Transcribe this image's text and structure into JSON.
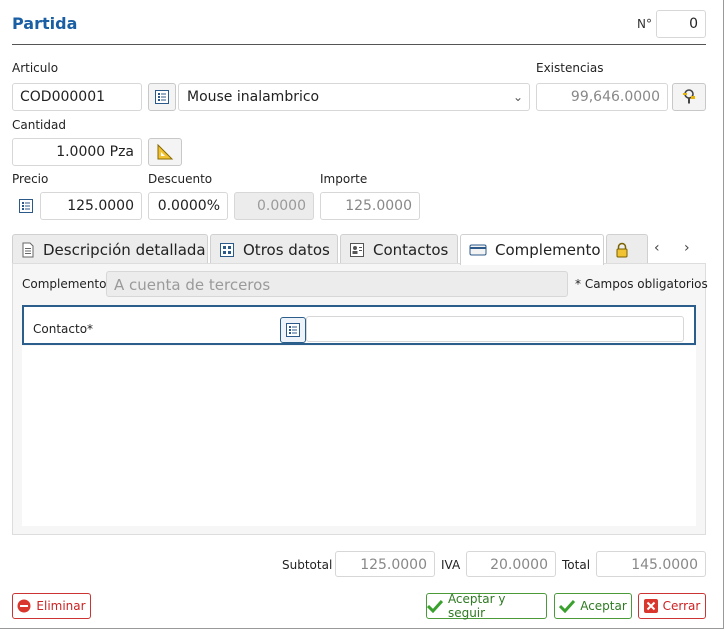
{
  "dialog": {
    "title": "Partida",
    "number_label": "N°",
    "number_value": "0"
  },
  "articulo": {
    "label": "Articulo",
    "code": "COD000001",
    "name": "Mouse inalambrico",
    "existencias_label": "Existencias",
    "existencias_value": "99,646.0000"
  },
  "cantidad": {
    "label": "Cantidad",
    "value": "1.0000 Pza"
  },
  "precio": {
    "label": "Precio",
    "value": "125.0000"
  },
  "descuento": {
    "label": "Descuento",
    "percent": "0.0000%",
    "amount": "0.0000"
  },
  "importe": {
    "label": "Importe",
    "value": "125.0000"
  },
  "tabs": [
    {
      "label": "Descripción detallada",
      "icon": "document-icon"
    },
    {
      "label": "Otros datos",
      "icon": "grid-icon"
    },
    {
      "label": "Contactos",
      "icon": "contacts-icon"
    },
    {
      "label": "Complemento",
      "icon": "card-icon"
    },
    {
      "label": "",
      "icon": "lock-icon"
    }
  ],
  "complemento": {
    "label": "Complemento",
    "value": "A cuenta de terceros",
    "required_note": "* Campos obligatorios",
    "contacto_label": "Contacto*",
    "contacto_value": ""
  },
  "totals": {
    "subtotal_label": "Subtotal",
    "subtotal_value": "125.0000",
    "iva_label": "IVA",
    "iva_value": "20.0000",
    "total_label": "Total",
    "total_value": "145.0000"
  },
  "buttons": {
    "eliminar": "Eliminar",
    "aceptar_seguir": "Aceptar y seguir",
    "aceptar": "Aceptar",
    "cerrar": "Cerrar"
  },
  "colors": {
    "accent": "#1a5fa3",
    "danger": "#cc2222",
    "success": "#2e7a22",
    "focus": "#2c5e8c"
  }
}
